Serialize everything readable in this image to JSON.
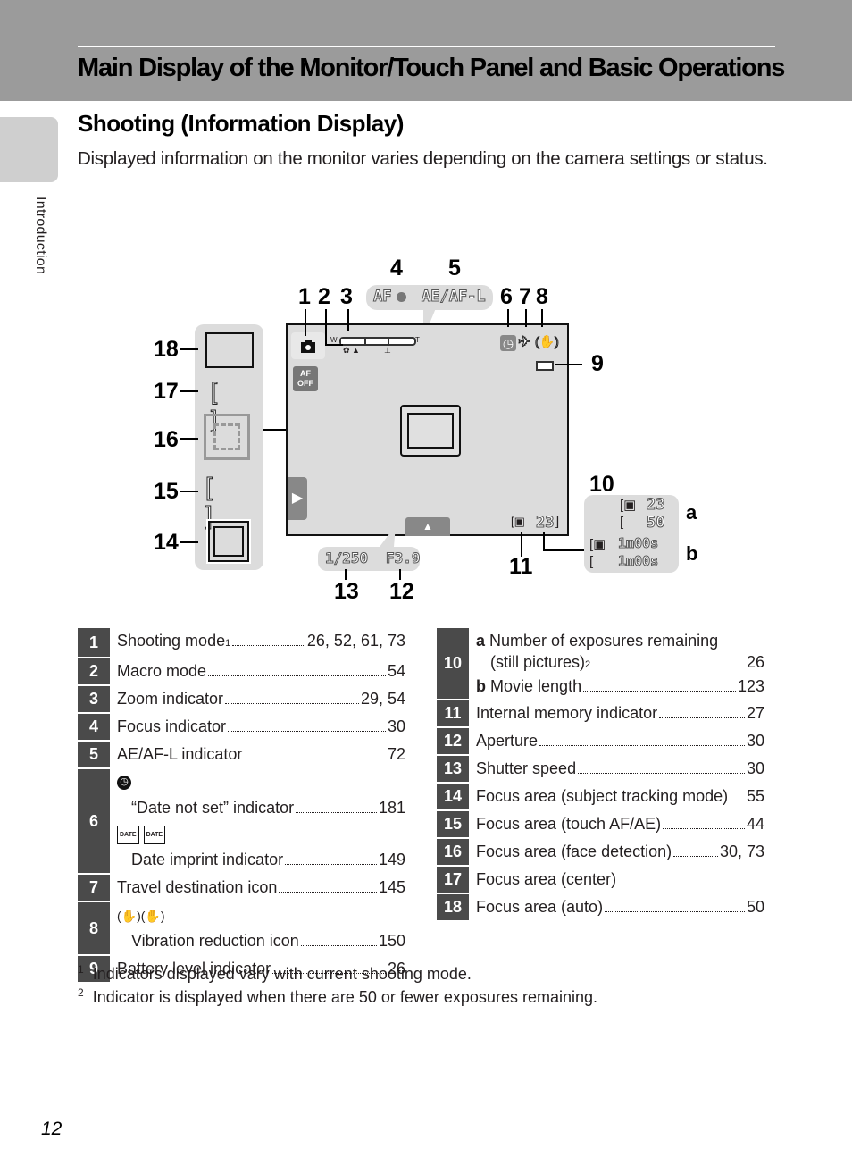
{
  "header": {
    "title": "Main Display of the Monitor/Touch Panel and Basic Operations"
  },
  "side_tab": {
    "label": "Introduction"
  },
  "section": {
    "title": "Shooting (Information Display)",
    "intro": "Displayed information on the monitor varies depending on the camera settings or status."
  },
  "diagram": {
    "callouts": [
      "1",
      "2",
      "3",
      "4",
      "5",
      "6",
      "7",
      "8",
      "9",
      "10",
      "11",
      "12",
      "13",
      "14",
      "15",
      "16",
      "17",
      "18"
    ],
    "labels": {
      "a": "a",
      "b": "b"
    },
    "af_text": "AF",
    "aeafl_text": "AE/AF-L",
    "zoom_w": "W",
    "zoom_t": "T",
    "touch_af_off": "AF OFF",
    "exposures_main": "23",
    "exp_a1": "23",
    "exp_a2": "50",
    "movie_b1": "1m00s",
    "movie_b2": "1m00s",
    "shutter": "1/250",
    "aperture": "F3.9",
    "icons": [
      "camera-icon",
      "macro-icon",
      "zoom-bar-icon",
      "focus-dot-icon",
      "clock-icon",
      "airplane-icon",
      "vibration-reduction-icon",
      "battery-icon",
      "internal-memory-icon",
      "touch-af-off-icon",
      "arrow-right-icon",
      "arrow-up-icon"
    ]
  },
  "table_left": [
    {
      "num": "1",
      "label": "Shooting mode",
      "sup": "1",
      "pages": "26, 52, 61, 73"
    },
    {
      "num": "2",
      "label": "Macro mode",
      "pages": "54"
    },
    {
      "num": "3",
      "label": "Zoom indicator",
      "pages": "29, 54"
    },
    {
      "num": "4",
      "label": "Focus indicator",
      "pages": "30"
    },
    {
      "num": "5",
      "label": "AE/AF-L indicator",
      "pages": "72"
    },
    {
      "num": "6",
      "sub": [
        {
          "icon": "clock-icon",
          "label": "“Date not set” indicator",
          "pages": "181"
        },
        {
          "icon": "date-imprint-icon",
          "label": "Date imprint indicator",
          "pages": "149"
        }
      ]
    },
    {
      "num": "7",
      "label": "Travel destination icon",
      "pages": "145"
    },
    {
      "num": "8",
      "sub": [
        {
          "icon": "vibration-reduction-icon",
          "label": "Vibration reduction icon",
          "pages": "150"
        }
      ]
    },
    {
      "num": "9",
      "label": "Battery level indicator",
      "pages": "26"
    }
  ],
  "table_right": [
    {
      "num": "10",
      "a_label": "a",
      "a_text": "Number of exposures remaining",
      "a_text2": "(still pictures)",
      "a_sup": "2",
      "a_pages": "26",
      "b_label": "b",
      "b_text": "Movie length",
      "b_pages": "123"
    },
    {
      "num": "11",
      "label": "Internal memory indicator",
      "pages": "27"
    },
    {
      "num": "12",
      "label": "Aperture",
      "pages": "30"
    },
    {
      "num": "13",
      "label": "Shutter speed",
      "pages": "30"
    },
    {
      "num": "14",
      "label": "Focus area (subject tracking mode)",
      "pages": "55"
    },
    {
      "num": "15",
      "label": "Focus area (touch AF/AE)",
      "pages": "44"
    },
    {
      "num": "16",
      "label": "Focus area (face detection)",
      "pages": "30, 73"
    },
    {
      "num": "17",
      "label": "Focus area (center)",
      "pages": ""
    },
    {
      "num": "18",
      "label": "Focus area (auto)",
      "pages": "50"
    }
  ],
  "footnotes": [
    {
      "mark": "1",
      "text": "Indicators displayed vary with current shooting mode."
    },
    {
      "mark": "2",
      "text": "Indicator is displayed when there are 50 or fewer exposures remaining."
    }
  ],
  "page_number": "12"
}
